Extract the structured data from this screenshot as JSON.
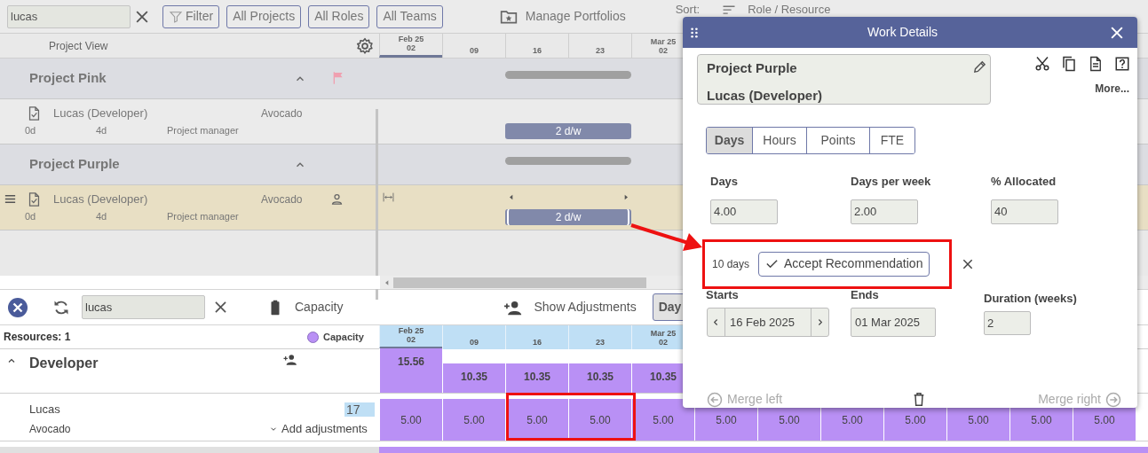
{
  "toolbar": {
    "search": {
      "value": "lucas"
    },
    "buttons": [
      "Filter",
      "All Projects",
      "All Roles",
      "All Teams"
    ],
    "manage_portfolios": "Manage Portfolios",
    "sort": {
      "label": "Sort:",
      "value": "Role / Resource"
    }
  },
  "project_view": {
    "title": "Project View",
    "timeline": [
      {
        "month": "Feb 25",
        "day": "02",
        "current": true
      },
      {
        "day": "09",
        "current": false
      },
      {
        "day": "16",
        "current": false
      },
      {
        "day": "23",
        "current": false
      },
      {
        "month": "Mar 25",
        "day": "02",
        "current": false
      }
    ],
    "projects": [
      {
        "name": "Project Pink",
        "expanded": true,
        "flagged": true,
        "items": [
          {
            "name": "Lucas (Developer)",
            "team": "Avocado",
            "start": "0d",
            "duration": "4d",
            "role": "Project manager",
            "bar": "2 d/w",
            "selected": false
          }
        ]
      },
      {
        "name": "Project Purple",
        "expanded": true,
        "flagged": false,
        "items": [
          {
            "name": "Lucas (Developer)",
            "team": "Avocado",
            "start": "0d",
            "duration": "4d",
            "role": "Project manager",
            "bar": "2 d/w",
            "selected": true
          }
        ]
      }
    ]
  },
  "capacity": {
    "search": {
      "value": "lucas"
    },
    "capacity_label": "Capacity",
    "show_adjustments": "Show Adjustments",
    "view_button": "Day",
    "resources_count": "Resources: 1",
    "legend": "Capacity",
    "timeline": [
      {
        "month": "Feb 25",
        "day": "02",
        "current": true
      },
      {
        "day": "09",
        "current": false
      },
      {
        "day": "16",
        "current": false
      },
      {
        "day": "23",
        "current": false
      },
      {
        "month": "Mar 25",
        "day": "02",
        "current": false
      }
    ],
    "roles": [
      {
        "name": "Developer",
        "expanded": true,
        "totals": [
          {
            "value": "15.56",
            "exceeded": true
          },
          {
            "value": "10.35",
            "exceeded": false
          },
          {
            "value": "10.35",
            "exceeded": false
          },
          {
            "value": "10.35",
            "exceeded": false
          },
          {
            "value": "10.35",
            "exceeded": false
          }
        ],
        "resources": [
          {
            "name": "Lucas",
            "team": "Avocado",
            "badge": "17",
            "add_adjustments": "Add adjustments",
            "values": [
              "5.00",
              "5.00",
              "5.00",
              "5.00",
              "5.00",
              "5.00",
              "5.00",
              "5.00",
              "5.00",
              "5.00",
              "5.00",
              "5.00"
            ]
          }
        ]
      }
    ]
  },
  "work_details": {
    "title": "Work Details",
    "project": "Project Purple",
    "assignment": "Lucas (Developer)",
    "more": "More...",
    "units": [
      {
        "label": "Days",
        "selected": true
      },
      {
        "label": "Hours",
        "selected": false
      },
      {
        "label": "Points",
        "selected": false
      },
      {
        "label": "FTE",
        "selected": false
      }
    ],
    "fields": [
      {
        "label": "Days",
        "value": "4.00"
      },
      {
        "label": "Days per week",
        "value": "2.00"
      },
      {
        "label": "% Allocated",
        "value": "40"
      }
    ],
    "recommendation": {
      "text": "10 days",
      "button": "Accept Recommendation"
    },
    "starts": {
      "label": "Starts",
      "value": "16 Feb 2025"
    },
    "ends": {
      "label": "Ends",
      "value": "01 Mar 2025"
    },
    "duration": {
      "label": "Duration (weeks)",
      "value": "2"
    },
    "merge_left": {
      "label": "Merge left",
      "disabled": true
    },
    "merge_right": {
      "label": "Merge right",
      "disabled": true
    }
  }
}
